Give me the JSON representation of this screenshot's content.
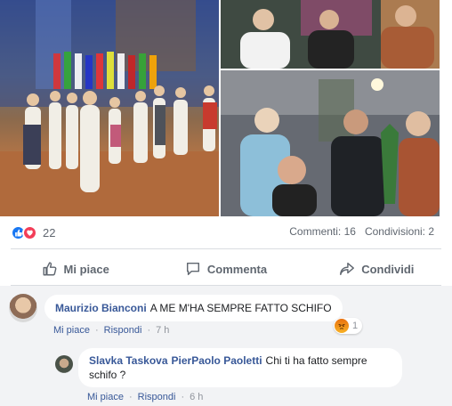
{
  "reactions": {
    "count": "22"
  },
  "stats": {
    "comments": "Commenti: 16",
    "shares": "Condivisioni: 2"
  },
  "actions": {
    "like": "Mi piace",
    "comment": "Commenta",
    "share": "Condividi"
  },
  "comments": [
    {
      "author": "Maurizio Bianconi",
      "text": "A ME M'HA SEMPRE FATTO SCHIFO",
      "like": "Mi piace",
      "reply": "Rispondi",
      "time": "7 h",
      "reaction_count": "1",
      "reaction_icon": "angry-icon"
    },
    {
      "author": "Slavka Taskova",
      "mention": "PierPaolo Paoletti",
      "text": "Chi ti ha fatto sempre schifo ?",
      "like": "Mi piace",
      "reply": "Rispondi",
      "time": "6 h"
    }
  ],
  "colors": {
    "link": "#385898",
    "like_blue": "#1877f2",
    "love_red": "#f33e58",
    "muted": "#606770"
  }
}
